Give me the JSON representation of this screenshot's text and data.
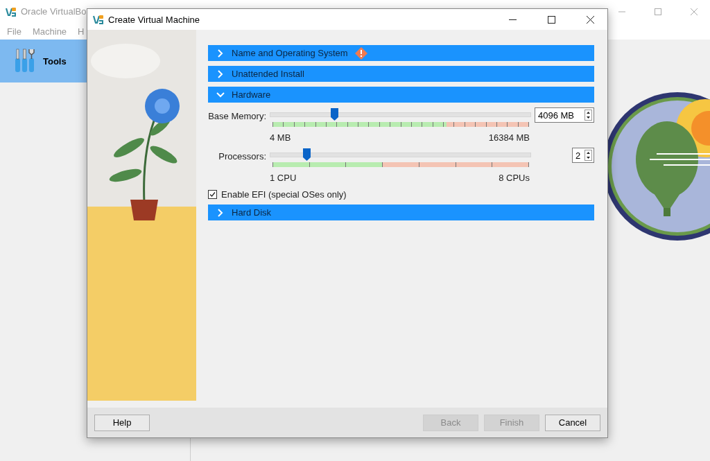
{
  "main_window": {
    "title": "Oracle VirtualBo",
    "menu": [
      "File",
      "Machine",
      "H"
    ],
    "tools": {
      "label": "Tools",
      "selected": true
    }
  },
  "dialog": {
    "title": "Create Virtual Machine",
    "sections": [
      {
        "title": "Name and Operating System",
        "expanded": false,
        "warning": true
      },
      {
        "title": "Unattended Install",
        "expanded": false,
        "warning": false
      },
      {
        "title": "Hardware",
        "expanded": true,
        "warning": false,
        "sliders": [
          {
            "label": "Base Memory:",
            "level": 0.25,
            "value": "4096 MB",
            "min": "4 MB",
            "max": "16384 MB"
          },
          {
            "label": "Processors:",
            "level": 0.143,
            "value": "2",
            "min": "1 CPU",
            "max": "8 CPUs"
          }
        ],
        "checkbox": {
          "label": "Enable EFI (special OSes only)",
          "checked": true
        }
      },
      {
        "title": "Hard Disk",
        "expanded": false,
        "warning": false
      }
    ],
    "buttons": [
      {
        "label": "Help",
        "disabled": false
      },
      {
        "label": "Back",
        "disabled": true
      },
      {
        "label": "Finish",
        "disabled": true
      },
      {
        "label": "Cancel",
        "disabled": false
      }
    ]
  }
}
